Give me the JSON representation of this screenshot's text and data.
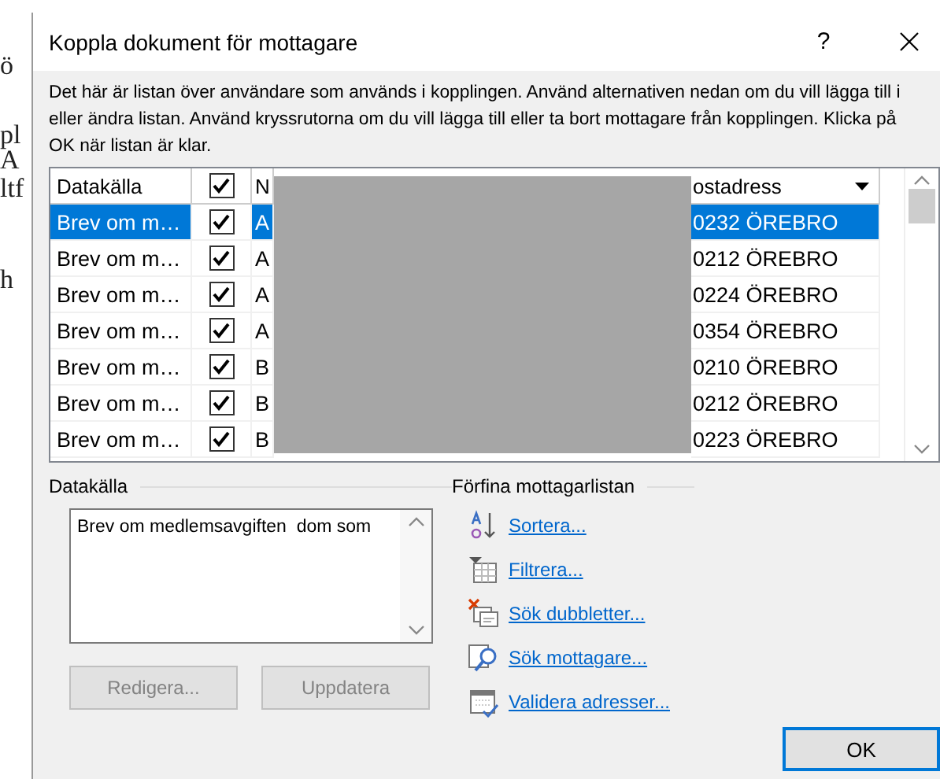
{
  "background_document": {
    "fragments": [
      "ö",
      "pl",
      "A",
      "ltf",
      "h"
    ]
  },
  "window": {
    "title": "Koppla dokument för mottagare",
    "help": "?"
  },
  "description": "Det här är listan över användare som används i kopplingen. Använd alternativen nedan om du vill lägga till i eller ändra listan. Använd kryssrutorna om du vill lägga till eller ta bort mottagare från kopplingen. Klicka på OK när listan är klar.",
  "table": {
    "columns": [
      {
        "kind": "text",
        "label": "Datakälla"
      },
      {
        "kind": "checkbox",
        "checked": true
      },
      {
        "kind": "text",
        "label": "N"
      },
      {
        "kind": "blank"
      },
      {
        "kind": "sort",
        "label": "ostadress"
      }
    ],
    "rows": [
      {
        "source": "Brev om m…",
        "checked": true,
        "name": "A",
        "address": "0232 ÖREBRO",
        "selected": true
      },
      {
        "source": "Brev om m…",
        "checked": true,
        "name": "A",
        "address": "0212 ÖREBRO",
        "selected": false
      },
      {
        "source": "Brev om m…",
        "checked": true,
        "name": "A",
        "address": "0224 ÖREBRO",
        "selected": false
      },
      {
        "source": "Brev om m…",
        "checked": true,
        "name": "A",
        "address": "0354 ÖREBRO",
        "selected": false
      },
      {
        "source": "Brev om m…",
        "checked": true,
        "name": "B",
        "address": "0210 ÖREBRO",
        "selected": false
      },
      {
        "source": "Brev om m…",
        "checked": true,
        "name": "B",
        "address": "0212 ÖREBRO",
        "selected": false
      },
      {
        "source": "Brev om m…",
        "checked": true,
        "name": "B",
        "address": "0223 ÖREBRO",
        "selected": false
      }
    ]
  },
  "data_source": {
    "heading": "Datakälla",
    "text": "Brev om medlemsavgiften  dom som",
    "buttons": [
      {
        "label": "Redigera...",
        "disabled": true
      },
      {
        "label": "Uppdatera",
        "disabled": true
      }
    ]
  },
  "refine": {
    "heading": "Förfina mottagarlistan",
    "links": [
      {
        "kind": "sort",
        "label": "Sortera..."
      },
      {
        "kind": "filter",
        "label": "Filtrera..."
      },
      {
        "kind": "duplicates",
        "label": "Sök dubbletter..."
      },
      {
        "kind": "find",
        "label": "Sök mottagare..."
      },
      {
        "kind": "validate",
        "label": "Validera adresser..."
      }
    ]
  },
  "ok_button": "OK"
}
